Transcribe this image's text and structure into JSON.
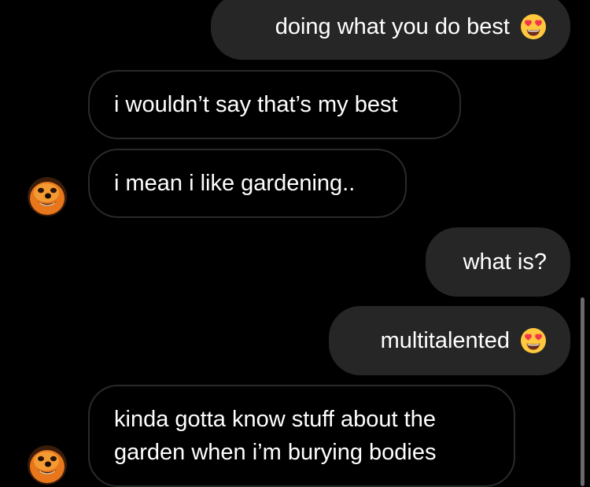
{
  "conversation": {
    "messages": [
      {
        "direction": "sent",
        "text": "doing what you do best",
        "emoji": "heart-eyes-emoji"
      },
      {
        "direction": "received",
        "text": "i wouldn’t say that’s my best"
      },
      {
        "direction": "received",
        "text": "i mean i like gardening.."
      },
      {
        "direction": "sent",
        "text": "what is?"
      },
      {
        "direction": "sent",
        "text": "multitalented",
        "emoji": "heart-eyes-emoji"
      },
      {
        "direction": "received",
        "lines": [
          "kinda gotta know stuff about the",
          "garden when i’m burying bodies"
        ]
      }
    ]
  },
  "colors": {
    "background": "#000000",
    "sent_bubble": "#262626",
    "received_border": "#2a2a2a",
    "text": "#ffffff",
    "emoji_face": "#FFC83D",
    "emoji_hearts": "#F2354B",
    "scrollbar": "#6a6a6a"
  },
  "icons": {
    "avatar": "contact-avatar",
    "emoji": "heart-eyes-emoji"
  }
}
